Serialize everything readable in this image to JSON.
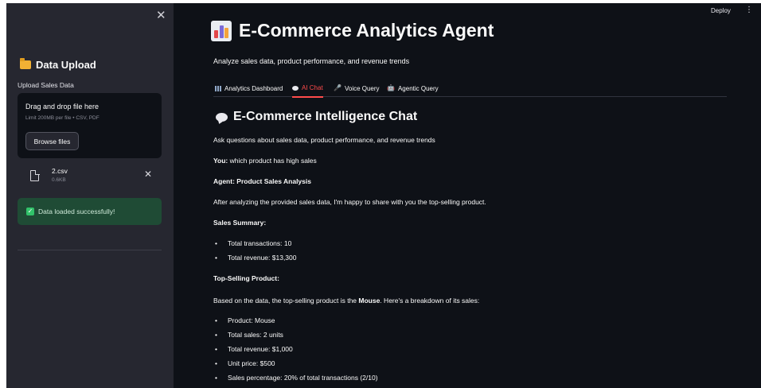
{
  "sidebar": {
    "close_icon": "close-icon",
    "title": "Data Upload",
    "upload_label": "Upload Sales Data",
    "dropzone": {
      "title": "Drag and drop file here",
      "limit": "Limit 200MB per file • CSV, PDF",
      "button": "Browse files"
    },
    "file": {
      "name": "2.csv",
      "size": "0.6KB"
    },
    "success": "Data loaded successfully!"
  },
  "header": {
    "deploy": "Deploy",
    "menu_icon": "kebab-menu-icon"
  },
  "main": {
    "title": "E-Commerce Analytics Agent",
    "subtitle": "Analyze sales data, product performance, and revenue trends",
    "tabs": [
      {
        "label": "Analytics Dashboard",
        "active": false
      },
      {
        "label": "AI Chat",
        "active": true
      },
      {
        "label": "Voice Query",
        "active": false
      },
      {
        "label": "Agentic Query",
        "active": false
      }
    ],
    "chat": {
      "title": "E-Commerce Intelligence Chat",
      "intro": "Ask questions about sales data, product performance, and revenue trends",
      "you_label": "You:",
      "you_text": "which product has high sales",
      "agent_label": "Agent: Product Sales Analysis",
      "p1": "After analyzing the provided sales data, I'm happy to share with you the top-selling product.",
      "summary_heading": "Sales Summary:",
      "summary": [
        "Total transactions: 10",
        "Total revenue: $13,300"
      ],
      "top_heading": "Top-Selling Product:",
      "p2_before": "Based on the data, the top-selling product is the ",
      "p2_bold": "Mouse",
      "p2_after": ". Here's a breakdown of its sales:",
      "details": [
        "Product: Mouse",
        "Total sales: 2 units",
        "Total revenue: $1,000",
        "Unit price: $500",
        "Sales percentage: 20% of total transactions (2/10)"
      ]
    }
  },
  "colors": {
    "sidebar_bg": "#262730",
    "main_bg": "#0e1117",
    "accent": "#ff4b4b",
    "success_bg": "#1f4b35"
  }
}
